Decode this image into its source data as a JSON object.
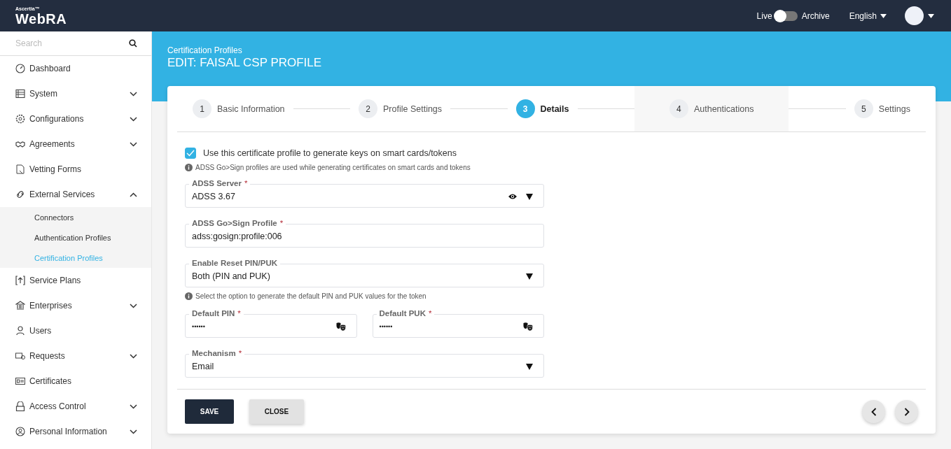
{
  "header": {
    "brand_small": "Ascertia™",
    "brand": "WebRA",
    "mode_toggle": {
      "left_label": "Live",
      "right_label": "Archive",
      "on": false
    },
    "language": "English"
  },
  "sidebar": {
    "search": {
      "placeholder": "Search"
    },
    "items": [
      {
        "label": "Dashboard",
        "expandable": false
      },
      {
        "label": "System",
        "expandable": true,
        "expanded": false
      },
      {
        "label": "Configurations",
        "expandable": true,
        "expanded": false
      },
      {
        "label": "Agreements",
        "expandable": true,
        "expanded": false
      },
      {
        "label": "Vetting Forms",
        "expandable": false
      },
      {
        "label": "External Services",
        "expandable": true,
        "expanded": true,
        "children": [
          {
            "label": "Connectors",
            "selected": false
          },
          {
            "label": "Authentication Profiles",
            "selected": false
          },
          {
            "label": "Certification Profiles",
            "selected": true
          }
        ]
      },
      {
        "label": "Service Plans",
        "expandable": false
      },
      {
        "label": "Enterprises",
        "expandable": true,
        "expanded": false
      },
      {
        "label": "Users",
        "expandable": false
      },
      {
        "label": "Requests",
        "expandable": true,
        "expanded": false
      },
      {
        "label": "Certificates",
        "expandable": false
      },
      {
        "label": "Access Control",
        "expandable": true,
        "expanded": false
      },
      {
        "label": "Personal Information",
        "expandable": true,
        "expanded": false
      }
    ]
  },
  "page": {
    "breadcrumb": "Certification Profiles",
    "title": "EDIT: FAISAL CSP PROFILE"
  },
  "steps": [
    {
      "number": "1",
      "label": "Basic Information",
      "selected": false,
      "hovered": false
    },
    {
      "number": "2",
      "label": "Profile Settings",
      "selected": false,
      "hovered": false
    },
    {
      "number": "3",
      "label": "Details",
      "selected": true,
      "hovered": false
    },
    {
      "number": "4",
      "label": "Authentications",
      "selected": false,
      "hovered": true
    },
    {
      "number": "5",
      "label": "Settings",
      "selected": false,
      "hovered": false
    }
  ],
  "form": {
    "checkbox": {
      "label": "Use this certificate profile to generate keys on smart cards/tokens",
      "checked": true
    },
    "hint": "ADSS Go>Sign profiles are used while generating certificates on smart cards and tokens",
    "items": [
      {
        "kind": "select",
        "label": "ADSS Server",
        "required_mark": "*",
        "value": "ADSS 3.67",
        "view_icon": true
      },
      {
        "kind": "text",
        "label": "ADSS Go>Sign Profile",
        "required_mark": "*",
        "value": "adss:gosign:profile:006"
      },
      {
        "kind": "select",
        "label": "Enable Reset PIN/PUK",
        "value": "Both (PIN and PUK)",
        "view_icon": false
      },
      {
        "kind": "hint",
        "text": "Select the option to generate the default PIN and PUK values for the token"
      },
      {
        "kind": "pair",
        "fields": [
          {
            "label": "Default PIN",
            "required_mark": "*",
            "value": "••••••"
          },
          {
            "label": "Default PUK",
            "required_mark": "*",
            "value": "••••••"
          }
        ]
      },
      {
        "kind": "select",
        "label": "Mechanism",
        "required_mark": "*",
        "value": "Email",
        "view_icon": false
      }
    ]
  },
  "footer": {
    "buttons": [
      {
        "label": "SAVE",
        "kind": "primary"
      },
      {
        "label": "CLOSE",
        "kind": "secondary"
      }
    ]
  }
}
